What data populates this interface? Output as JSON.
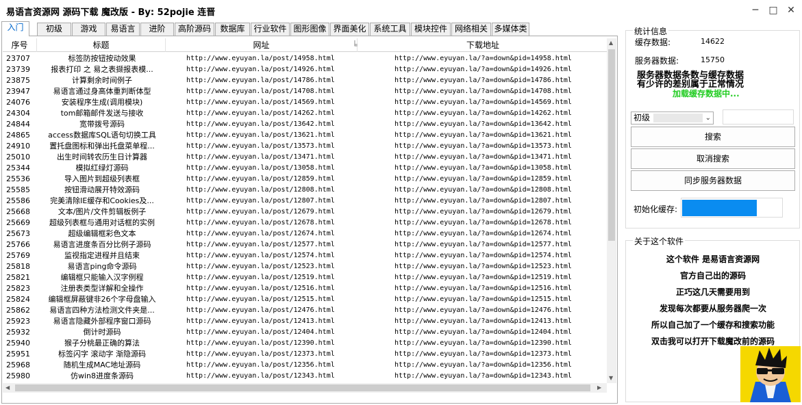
{
  "window": {
    "title": "易语言资源网 源码下载 魔改版 - By: 52pojie 连晋"
  },
  "tabs": [
    "入门",
    "初级",
    "游戏",
    "易语言",
    "进阶",
    "高阶源码",
    "数据库",
    "行业软件",
    "图形图像",
    "界面美化",
    "系统工具",
    "模块控件",
    "网络相关",
    "多媒体类"
  ],
  "grid": {
    "headers": {
      "id": "序号",
      "title": "标题",
      "url": "网址",
      "url_extra": "╘",
      "download": "下载地址"
    },
    "rows": [
      {
        "id": "23707",
        "title": "标签防按钮按动效果",
        "url": "http://www.eyuyan.la/post/14958.html",
        "download": "http://www.eyuyan.la/?a=down&pid=14958.html"
      },
      {
        "id": "23739",
        "title": "报表打印 之 易之表撷报表模...",
        "url": "http://www.eyuyan.la/post/14926.html",
        "download": "http://www.eyuyan.la/?a=down&pid=14926.html"
      },
      {
        "id": "23875",
        "title": "计算剩余时间例子",
        "url": "http://www.eyuyan.la/post/14786.html",
        "download": "http://www.eyuyan.la/?a=down&pid=14786.html"
      },
      {
        "id": "23947",
        "title": "易语言通过身高体重判断体型",
        "url": "http://www.eyuyan.la/post/14708.html",
        "download": "http://www.eyuyan.la/?a=down&pid=14708.html"
      },
      {
        "id": "24076",
        "title": "安装程序生成(调用模块)",
        "url": "http://www.eyuyan.la/post/14569.html",
        "download": "http://www.eyuyan.la/?a=down&pid=14569.html"
      },
      {
        "id": "24304",
        "title": "tom邮箱邮件发送与接收",
        "url": "http://www.eyuyan.la/post/14262.html",
        "download": "http://www.eyuyan.la/?a=down&pid=14262.html"
      },
      {
        "id": "24844",
        "title": "宽带拨号源码",
        "url": "http://www.eyuyan.la/post/13642.html",
        "download": "http://www.eyuyan.la/?a=down&pid=13642.html"
      },
      {
        "id": "24865",
        "title": "access数据库SQL语句切换工具",
        "url": "http://www.eyuyan.la/post/13621.html",
        "download": "http://www.eyuyan.la/?a=down&pid=13621.html"
      },
      {
        "id": "24910",
        "title": "置托盘图标和弹出托盘菜单程...",
        "url": "http://www.eyuyan.la/post/13573.html",
        "download": "http://www.eyuyan.la/?a=down&pid=13573.html"
      },
      {
        "id": "25010",
        "title": "出生时间转农历生日计算器",
        "url": "http://www.eyuyan.la/post/13471.html",
        "download": "http://www.eyuyan.la/?a=down&pid=13471.html"
      },
      {
        "id": "25344",
        "title": "模拟红绿灯源码",
        "url": "http://www.eyuyan.la/post/13058.html",
        "download": "http://www.eyuyan.la/?a=down&pid=13058.html"
      },
      {
        "id": "25536",
        "title": "导入图片到超级列表框",
        "url": "http://www.eyuyan.la/post/12859.html",
        "download": "http://www.eyuyan.la/?a=down&pid=12859.html"
      },
      {
        "id": "25585",
        "title": "按钮滑动展开特效源码",
        "url": "http://www.eyuyan.la/post/12808.html",
        "download": "http://www.eyuyan.la/?a=down&pid=12808.html"
      },
      {
        "id": "25586",
        "title": "完美清除IE缓存和Cookies及...",
        "url": "http://www.eyuyan.la/post/12807.html",
        "download": "http://www.eyuyan.la/?a=down&pid=12807.html"
      },
      {
        "id": "25668",
        "title": "文本/图片/文件剪辑板例子",
        "url": "http://www.eyuyan.la/post/12679.html",
        "download": "http://www.eyuyan.la/?a=down&pid=12679.html"
      },
      {
        "id": "25669",
        "title": "超级列表框与通用对话框的实例",
        "url": "http://www.eyuyan.la/post/12678.html",
        "download": "http://www.eyuyan.la/?a=down&pid=12678.html"
      },
      {
        "id": "25673",
        "title": "超级编辑框彩色文本",
        "url": "http://www.eyuyan.la/post/12674.html",
        "download": "http://www.eyuyan.la/?a=down&pid=12674.html"
      },
      {
        "id": "25766",
        "title": "易语言进度条百分比例子源码",
        "url": "http://www.eyuyan.la/post/12577.html",
        "download": "http://www.eyuyan.la/?a=down&pid=12577.html"
      },
      {
        "id": "25769",
        "title": "监视指定进程并且结束",
        "url": "http://www.eyuyan.la/post/12574.html",
        "download": "http://www.eyuyan.la/?a=down&pid=12574.html"
      },
      {
        "id": "25818",
        "title": "易语言ping命令源码",
        "url": "http://www.eyuyan.la/post/12523.html",
        "download": "http://www.eyuyan.la/?a=down&pid=12523.html"
      },
      {
        "id": "25821",
        "title": "编辑框只能输入汉字例程",
        "url": "http://www.eyuyan.la/post/12519.html",
        "download": "http://www.eyuyan.la/?a=down&pid=12519.html"
      },
      {
        "id": "25823",
        "title": "注册表类型详解和全操作",
        "url": "http://www.eyuyan.la/post/12516.html",
        "download": "http://www.eyuyan.la/?a=down&pid=12516.html"
      },
      {
        "id": "25824",
        "title": "编辑框屏蔽键非26个字母盘输入",
        "url": "http://www.eyuyan.la/post/12515.html",
        "download": "http://www.eyuyan.la/?a=down&pid=12515.html"
      },
      {
        "id": "25862",
        "title": "易语言四种方法检测文件夹是...",
        "url": "http://www.eyuyan.la/post/12476.html",
        "download": "http://www.eyuyan.la/?a=down&pid=12476.html"
      },
      {
        "id": "25923",
        "title": "易语言隐藏外部程序窗口源码",
        "url": "http://www.eyuyan.la/post/12413.html",
        "download": "http://www.eyuyan.la/?a=down&pid=12413.html"
      },
      {
        "id": "25932",
        "title": "倒计时源码",
        "url": "http://www.eyuyan.la/post/12404.html",
        "download": "http://www.eyuyan.la/?a=down&pid=12404.html"
      },
      {
        "id": "25940",
        "title": "猴子分桃最正确的算法",
        "url": "http://www.eyuyan.la/post/12390.html",
        "download": "http://www.eyuyan.la/?a=down&pid=12390.html"
      },
      {
        "id": "25951",
        "title": "标签闪字 滚动字 渐隐源码",
        "url": "http://www.eyuyan.la/post/12373.html",
        "download": "http://www.eyuyan.la/?a=down&pid=12373.html"
      },
      {
        "id": "25968",
        "title": "随机生成MAC地址源码",
        "url": "http://www.eyuyan.la/post/12356.html",
        "download": "http://www.eyuyan.la/?a=down&pid=12356.html"
      },
      {
        "id": "25980",
        "title": "仿win8进度条源码",
        "url": "http://www.eyuyan.la/post/12343.html",
        "download": "http://www.eyuyan.la/?a=down&pid=12343.html"
      }
    ]
  },
  "stats": {
    "group_label": "统计信息",
    "cache_label": "缓存数据:",
    "cache_value": "14622",
    "server_label": "服务器数据:",
    "server_value": "15750",
    "note_line1": "服务器数据条数与缓存数据",
    "note_line2": "有少许的差别属于正常情况",
    "loading": "加载缓存数据中..."
  },
  "controls": {
    "category_selected": "初级",
    "search_button": "搜索",
    "cancel_button": "取消搜索",
    "sync_button": "同步服务器数据",
    "init_cache_label": "初始化缓存:",
    "init_cache_progress": 0.75
  },
  "about": {
    "group_label": "关于这个软件",
    "lines": [
      "这个软件 是易语言资源网",
      "官方自己出的源码",
      "正巧这几天需要用到",
      "发现每次都要从服务器爬一次",
      "所以自己加了一个缓存和搜索功能",
      "双击我可以打开下载魔改前的源码"
    ]
  },
  "colors": {
    "loading_text": "#22cc22",
    "progress_fill": "#0a8cf0",
    "avatar_bg": "#f5d800"
  }
}
